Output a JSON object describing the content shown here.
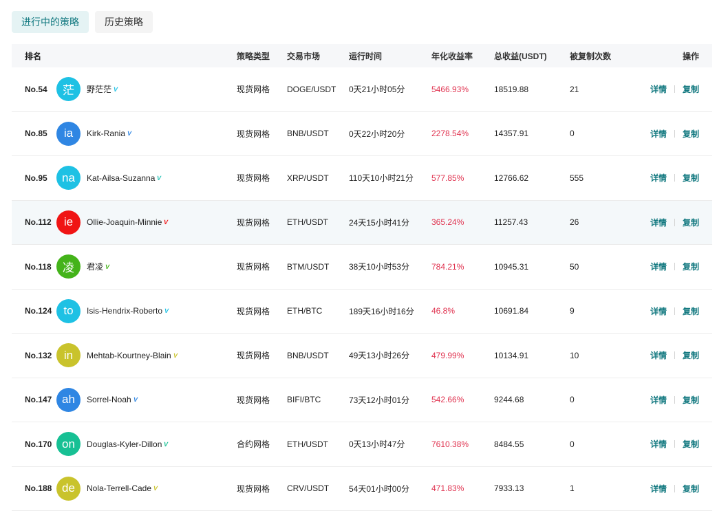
{
  "tabs": [
    {
      "label": "进行中的策略",
      "active": true
    },
    {
      "label": "历史策略",
      "active": false
    }
  ],
  "columns": {
    "rank": "排名",
    "type": "策略类型",
    "market": "交易市场",
    "time": "运行时间",
    "yield": "年化收益率",
    "total": "总收益(USDT)",
    "copies": "被复制次数",
    "ops": "操作"
  },
  "actions": {
    "detail": "详情",
    "copy": "复制"
  },
  "rows": [
    {
      "rank": "No.54",
      "avatar_text": "茫",
      "avatar_color": "#1ec1e4",
      "vip_color": "#1ec1e4",
      "name": "野茫茫",
      "type": "现货网格",
      "market": "DOGE/USDT",
      "time": "0天21小时05分",
      "yield": "5466.93%",
      "total": "18519.88",
      "copies": "21"
    },
    {
      "rank": "No.85",
      "avatar_text": "ia",
      "avatar_color": "#2f86e3",
      "vip_color": "#2f86e3",
      "name": "Kirk-Rania",
      "type": "现货网格",
      "market": "BNB/USDT",
      "time": "0天22小时20分",
      "yield": "2278.54%",
      "total": "14357.91",
      "copies": "0"
    },
    {
      "rank": "No.95",
      "avatar_text": "na",
      "avatar_color": "#1ec1e4",
      "vip_color": "#1ec1b4",
      "name": "Kat-Ailsa-Suzanna",
      "type": "现货网格",
      "market": "XRP/USDT",
      "time": "110天10小时21分",
      "yield": "577.85%",
      "total": "12766.62",
      "copies": "555"
    },
    {
      "rank": "No.112",
      "avatar_text": "ie",
      "avatar_color": "#f01414",
      "vip_color": "#f01414",
      "name": "Ollie-Joaquin-Minnie",
      "type": "现货网格",
      "market": "ETH/USDT",
      "time": "24天15小时41分",
      "yield": "365.24%",
      "total": "11257.43",
      "copies": "26"
    },
    {
      "rank": "No.118",
      "avatar_text": "凌",
      "avatar_color": "#44b31a",
      "vip_color": "#44b31a",
      "name": "君凌",
      "type": "现货网格",
      "market": "BTM/USDT",
      "time": "38天10小时53分",
      "yield": "784.21%",
      "total": "10945.31",
      "copies": "50"
    },
    {
      "rank": "No.124",
      "avatar_text": "to",
      "avatar_color": "#1ec1e4",
      "vip_color": "#1ec1e4",
      "name": "Isis-Hendrix-Roberto",
      "type": "现货网格",
      "market": "ETH/BTC",
      "time": "189天16小时16分",
      "yield": "46.8%",
      "total": "10691.84",
      "copies": "9"
    },
    {
      "rank": "No.132",
      "avatar_text": "in",
      "avatar_color": "#c9c32c",
      "vip_color": "#c9c32c",
      "name": "Mehtab-Kourtney-Blain",
      "type": "现货网格",
      "market": "BNB/USDT",
      "time": "49天13小时26分",
      "yield": "479.99%",
      "total": "10134.91",
      "copies": "10"
    },
    {
      "rank": "No.147",
      "avatar_text": "ah",
      "avatar_color": "#2f86e3",
      "vip_color": "#2f86e3",
      "name": "Sorrel-Noah",
      "type": "现货网格",
      "market": "BIFI/BTC",
      "time": "73天12小时01分",
      "yield": "542.66%",
      "total": "9244.68",
      "copies": "0"
    },
    {
      "rank": "No.170",
      "avatar_text": "on",
      "avatar_color": "#17c094",
      "vip_color": "#17c094",
      "name": "Douglas-Kyler-Dillon",
      "type": "合约网格",
      "market": "ETH/USDT",
      "time": "0天13小时47分",
      "yield": "7610.38%",
      "total": "8484.55",
      "copies": "0"
    },
    {
      "rank": "No.188",
      "avatar_text": "de",
      "avatar_color": "#c9c32c",
      "vip_color": "#c9c32c",
      "name": "Nola-Terrell-Cade",
      "type": "现货网格",
      "market": "CRV/USDT",
      "time": "54天01小时00分",
      "yield": "471.83%",
      "total": "7933.13",
      "copies": "1"
    }
  ],
  "highlight_row": 3,
  "colors": {
    "accent": "#11787f",
    "yield": "#e0324f"
  }
}
